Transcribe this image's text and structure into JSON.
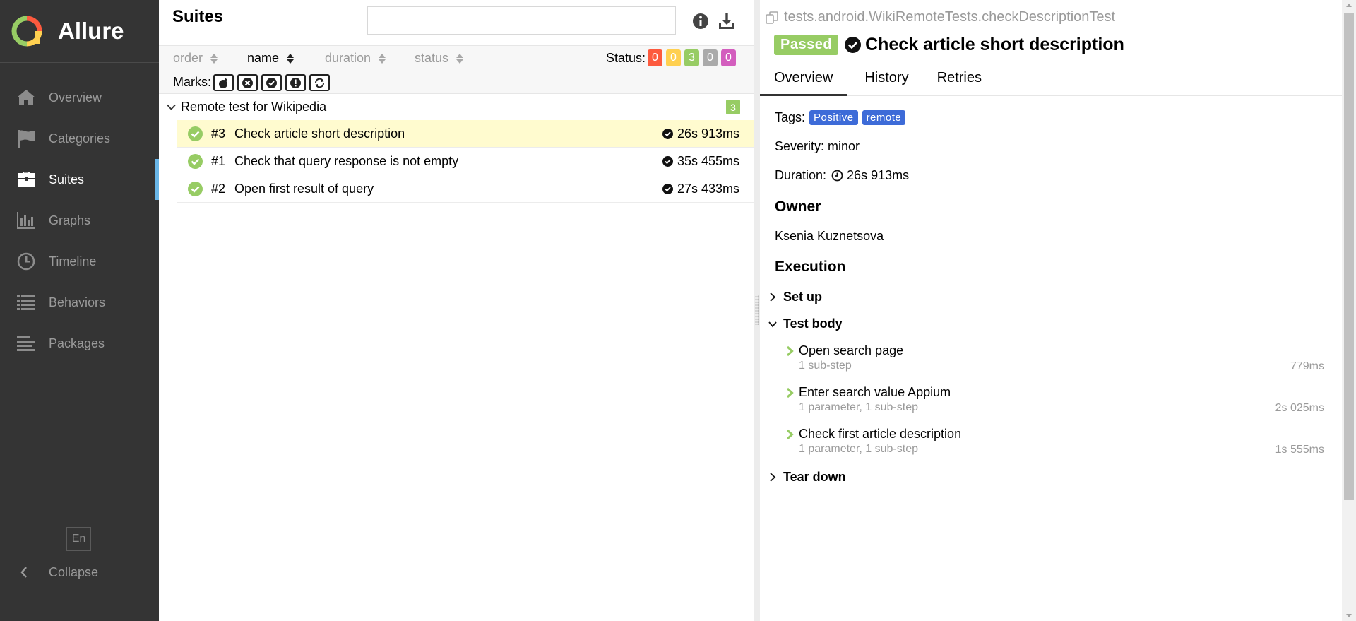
{
  "app": {
    "name": "Allure"
  },
  "sidebar": {
    "items": [
      {
        "label": "Overview",
        "icon": "home-icon"
      },
      {
        "label": "Categories",
        "icon": "flag-icon"
      },
      {
        "label": "Suites",
        "icon": "briefcase-icon",
        "active": true
      },
      {
        "label": "Graphs",
        "icon": "bar-chart-icon"
      },
      {
        "label": "Timeline",
        "icon": "clock-icon"
      },
      {
        "label": "Behaviors",
        "icon": "list-icon"
      },
      {
        "label": "Packages",
        "icon": "align-left-icon"
      }
    ],
    "language": "En",
    "collapse_label": "Collapse"
  },
  "suites": {
    "title": "Suites",
    "search_value": "",
    "sorters": [
      {
        "label": "order"
      },
      {
        "label": "name",
        "active": true
      },
      {
        "label": "duration"
      },
      {
        "label": "status"
      }
    ],
    "status_label": "Status:",
    "status_counts": [
      {
        "status": "failed",
        "count": "0",
        "color": "#fd5a3e"
      },
      {
        "status": "broken",
        "count": "0",
        "color": "#ffd050"
      },
      {
        "status": "passed",
        "count": "3",
        "color": "#97cc64"
      },
      {
        "status": "skipped",
        "count": "0",
        "color": "#aaaaaa"
      },
      {
        "status": "unknown",
        "count": "0",
        "color": "#d35ebe"
      }
    ],
    "marks_label": "Marks:",
    "marks": [
      "flaky-mark-icon",
      "new-failed-mark-icon",
      "new-passed-mark-icon",
      "new-broken-mark-icon",
      "retries-status-change-mark-icon"
    ],
    "group": {
      "name": "Remote test for Wikipedia",
      "count": "3"
    },
    "tests": [
      {
        "num": "#3",
        "name": "Check article short description",
        "duration": "26s 913ms",
        "selected": true
      },
      {
        "num": "#1",
        "name": "Check that query response is not empty",
        "duration": "35s 455ms"
      },
      {
        "num": "#2",
        "name": "Open first result of query",
        "duration": "27s 433ms"
      }
    ]
  },
  "details": {
    "fullname": "tests.android.WikiRemoteTests.checkDescriptionTest",
    "status": "Passed",
    "title": "Check article short description",
    "tabs": [
      "Overview",
      "History",
      "Retries"
    ],
    "tags_label": "Tags:",
    "tags": [
      "Positive",
      "remote"
    ],
    "severity_label": "Severity: minor",
    "duration_label": "Duration:",
    "duration": "26s 913ms",
    "owner_heading": "Owner",
    "owner": "Ksenia Kuznetsova",
    "execution_heading": "Execution",
    "setup_label": "Set up",
    "test_body_label": "Test body",
    "steps": [
      {
        "name": "Open search page",
        "sub": "1 sub-step",
        "duration": "779ms"
      },
      {
        "name": "Enter search value Appium",
        "sub": "1 parameter, 1 sub-step",
        "duration": "2s 025ms"
      },
      {
        "name": "Check first article description",
        "sub": "1 parameter, 1 sub-step",
        "duration": "1s 555ms"
      }
    ],
    "teardown_label": "Tear down"
  },
  "colors": {
    "sidebar_bg": "#343434",
    "active_accent": "#69b6e8",
    "passed": "#97cc64",
    "tag": "#3d6bd8",
    "selected_row": "#fffbcf"
  }
}
